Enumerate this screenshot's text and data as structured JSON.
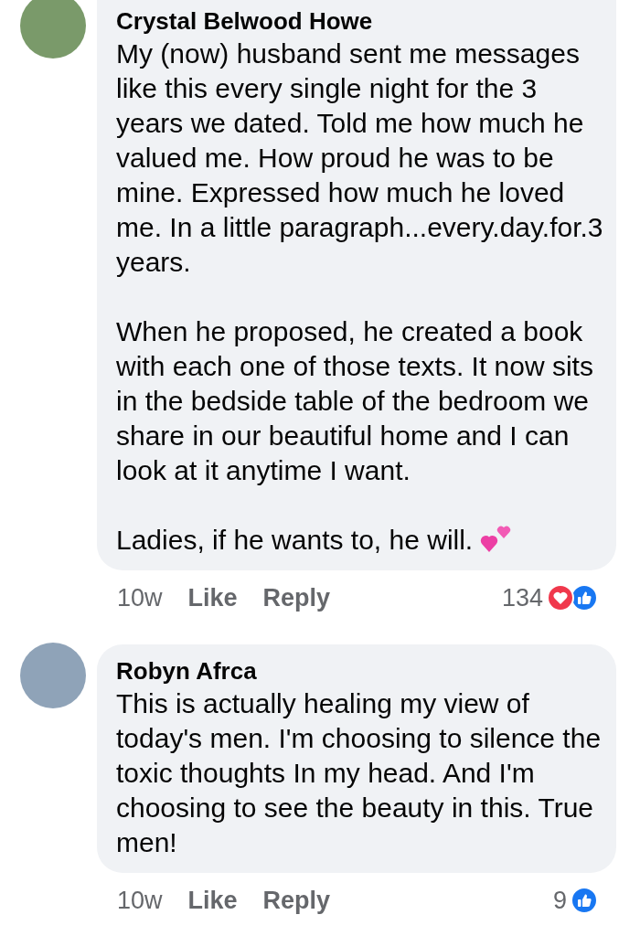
{
  "comments": [
    {
      "author": "Crystal Belwood Howe",
      "paragraphs": [
        "My (now) husband sent me messages like this every single night for the 3 years we dated. Told me how much he valued me. How proud he was to be mine. Expressed how much he loved me. In a little paragraph...every.day.for.3 years.",
        "When he proposed, he created a book with each one of those texts. It now sits in the bedside table of the bedroom we share in our beautiful home and I can look at it anytime I want.",
        "Ladies, if he wants to, he will."
      ],
      "time": "10w",
      "like": "Like",
      "reply": "Reply",
      "reaction_count": "134",
      "reactions": [
        {
          "kind": "love"
        },
        {
          "kind": "like"
        }
      ]
    },
    {
      "author": "Robyn Afrca",
      "paragraphs": [
        "This is actually healing my view of today's men. I'm choosing to silence the toxic thoughts In my head. And I'm choosing to see the beauty in this. True men!"
      ],
      "time": "10w",
      "like": "Like",
      "reply": "Reply",
      "reaction_count": "9",
      "reactions": [
        {
          "kind": "like"
        }
      ]
    }
  ]
}
